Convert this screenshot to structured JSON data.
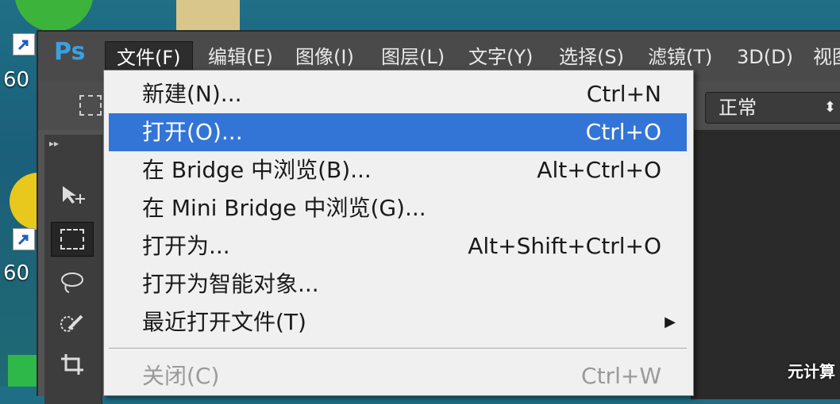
{
  "desktop": {
    "icon_labels": [
      "60",
      "60"
    ]
  },
  "app": {
    "logo": "Ps",
    "menus": [
      {
        "label": "文件(F)",
        "active": true
      },
      {
        "label": "编辑(E)"
      },
      {
        "label": "图像(I)"
      },
      {
        "label": "图层(L)"
      },
      {
        "label": "文字(Y)"
      },
      {
        "label": "选择(S)"
      },
      {
        "label": "滤镜(T)"
      },
      {
        "label": "3D(D)"
      },
      {
        "label": "视图"
      }
    ],
    "blend_mode": "正常",
    "tools": [
      "move-tool",
      "marquee-tool",
      "lasso-tool",
      "quick-selection-tool",
      "crop-tool"
    ]
  },
  "file_menu": {
    "items": [
      {
        "label": "新建(N)...",
        "shortcut": "Ctrl+N"
      },
      {
        "label": "打开(O)...",
        "shortcut": "Ctrl+O",
        "highlighted": true
      },
      {
        "label": "在 Bridge 中浏览(B)...",
        "shortcut": "Alt+Ctrl+O"
      },
      {
        "label": "在 Mini Bridge 中浏览(G)...",
        "shortcut": ""
      },
      {
        "label": "打开为...",
        "shortcut": "Alt+Shift+Ctrl+O"
      },
      {
        "label": "打开为智能对象...",
        "shortcut": ""
      },
      {
        "label": "最近打开文件(T)",
        "shortcut": "",
        "submenu": true
      },
      {
        "label": "关闭(C)",
        "shortcut": "Ctrl+W",
        "disabled": true
      }
    ]
  },
  "watermark": "元计算"
}
